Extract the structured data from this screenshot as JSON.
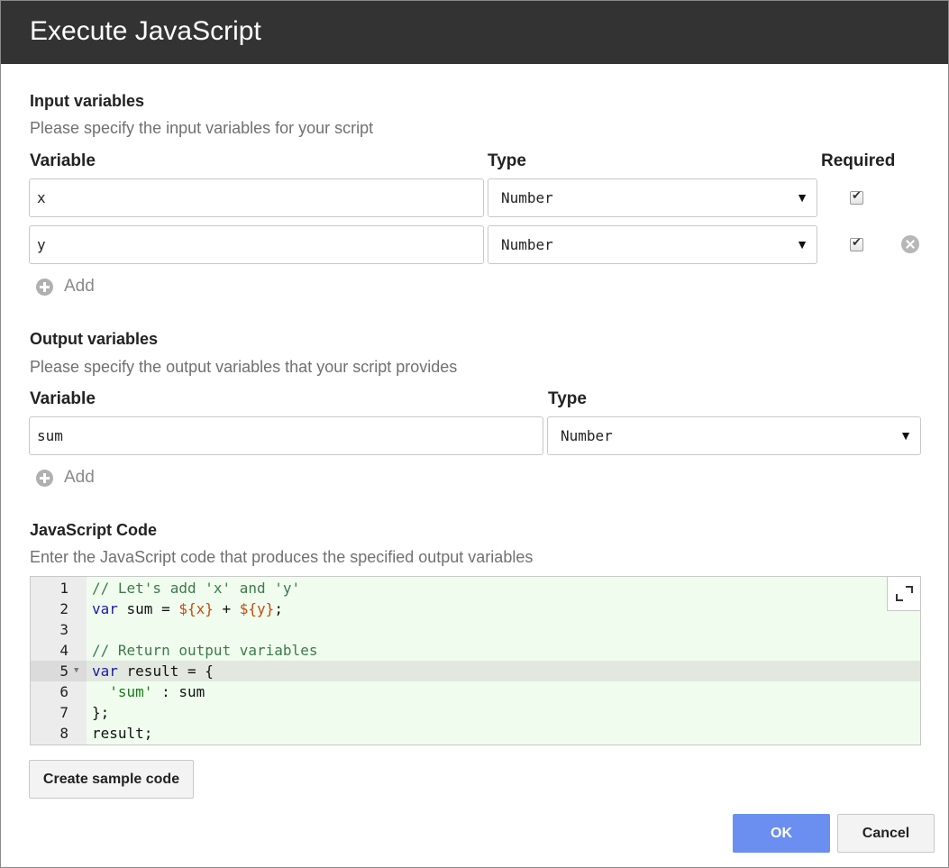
{
  "dialog": {
    "title": "Execute JavaScript"
  },
  "input_section": {
    "title": "Input variables",
    "description": "Please specify the input variables for your script",
    "headers": {
      "variable": "Variable",
      "type": "Type",
      "required": "Required"
    },
    "rows": [
      {
        "variable": "x",
        "type": "Number",
        "required": true
      },
      {
        "variable": "y",
        "type": "Number",
        "required": true
      }
    ],
    "add_label": "Add"
  },
  "output_section": {
    "title": "Output variables",
    "description": "Please specify the output variables that your script provides",
    "headers": {
      "variable": "Variable",
      "type": "Type"
    },
    "rows": [
      {
        "variable": "sum",
        "type": "Number"
      }
    ],
    "add_label": "Add"
  },
  "code_section": {
    "title": "JavaScript Code",
    "description": "Enter the JavaScript code that produces the specified output variables",
    "line_numbers": [
      "1",
      "2",
      "3",
      "4",
      "5",
      "6",
      "7",
      "8"
    ],
    "lines": [
      "// Let's add 'x' and 'y'",
      "var sum = ${x} + ${y};",
      "",
      "// Return output variables",
      "var result = {",
      "  'sum' : sum",
      "};",
      "result;"
    ],
    "active_line": 5
  },
  "buttons": {
    "create_sample": "Create sample code",
    "ok": "OK",
    "cancel": "Cancel"
  },
  "icons": {
    "caret": "chevron-down-icon",
    "add": "plus-circle-icon",
    "remove": "close-circle-icon",
    "expand": "expand-icon"
  },
  "colors": {
    "titlebar": "#333333",
    "primary_button": "#6b8ff0",
    "editor_background": "#f0fdee"
  }
}
